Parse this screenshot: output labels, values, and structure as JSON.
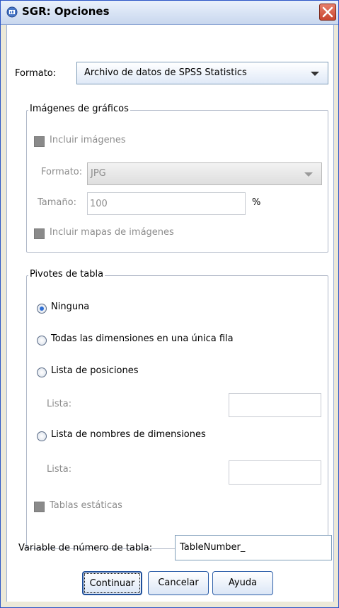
{
  "window": {
    "title": "SGR: Opciones"
  },
  "format": {
    "label": "Formato:",
    "value": "Archivo de datos de SPSS Statistics"
  },
  "images_group": {
    "title": "Imágenes de gráficos",
    "include_images": "Incluir imágenes",
    "format_label": "Formato:",
    "format_value": "JPG",
    "size_label": "Tamaño:",
    "size_value": "100",
    "size_unit": "%",
    "include_maps": "Incluir mapas de imágenes"
  },
  "pivot_group": {
    "title": "Pivotes de tabla",
    "option_none": "Ninguna",
    "option_all_dims": "Todas las dimensiones en una única fila",
    "option_positions": "Lista de posiciones",
    "list_label_1": "Lista:",
    "option_dim_names": "Lista de nombres de dimensiones",
    "list_label_2": "Lista:",
    "static_tables": "Tablas estáticas",
    "selected": "Ninguna"
  },
  "table_number": {
    "label": "Variable de número de tabla:",
    "value": "TableNumber_"
  },
  "buttons": {
    "continue": "Continuar",
    "cancel": "Cancelar",
    "help": "Ayuda"
  }
}
